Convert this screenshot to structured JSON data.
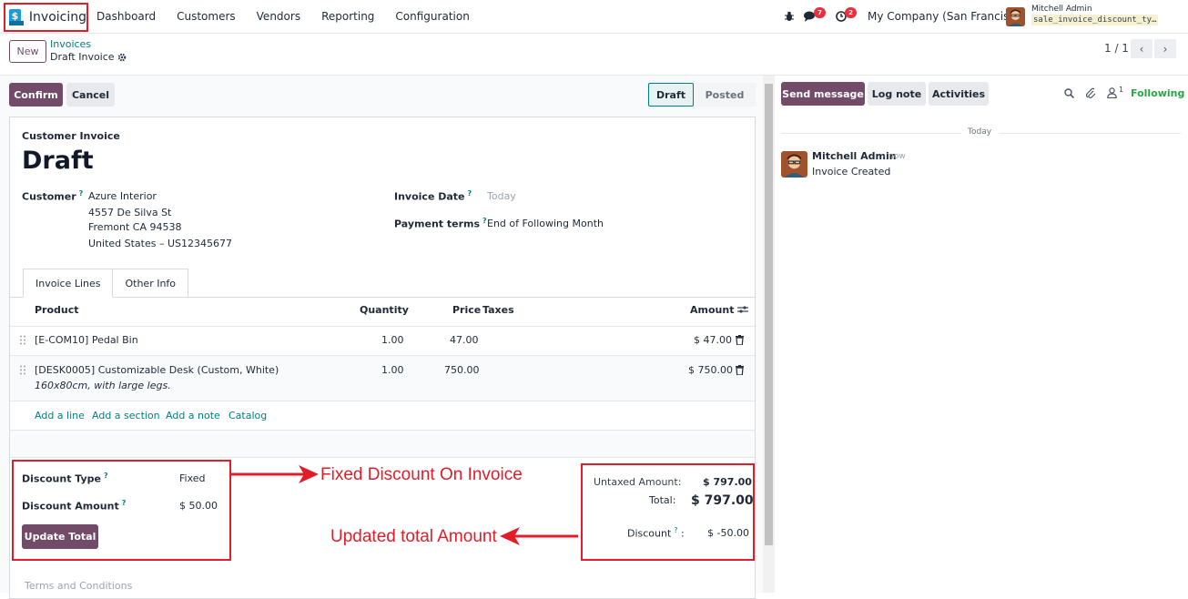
{
  "topbar": {
    "app_name": "Invoicing",
    "app_icon_glyph": "$",
    "menu": [
      "Dashboard",
      "Customers",
      "Vendors",
      "Reporting",
      "Configuration"
    ],
    "chat_count": "7",
    "activity_count": "2",
    "company": "My Company (San Francisco)",
    "user_name": "Mitchell Admin",
    "database": "sale_invoice_discount_ty…"
  },
  "control_panel": {
    "new_label": "New",
    "breadcrumb_parent": "Invoices",
    "breadcrumb_current": "Draft Invoice",
    "pager": "1 / 1"
  },
  "actions": {
    "confirm": "Confirm",
    "cancel": "Cancel",
    "status_draft": "Draft",
    "status_posted": "Posted"
  },
  "invoice": {
    "type_label": "Customer Invoice",
    "name": "Draft",
    "customer_label": "Customer",
    "customer_name": "Azure Interior",
    "address_line1": "4557 De Silva St",
    "address_line2": "Fremont CA 94538",
    "address_line3": "United States – US12345677",
    "date_label": "Invoice Date",
    "date_value": "Today",
    "terms_label": "Payment terms",
    "terms_value": "End of Following Month",
    "help_mark": "?"
  },
  "tabs": [
    "Invoice Lines",
    "Other Info"
  ],
  "lines": {
    "headers": {
      "product": "Product",
      "quantity": "Quantity",
      "price": "Price",
      "taxes": "Taxes",
      "amount": "Amount"
    },
    "rows": [
      {
        "product": "[E-COM10] Pedal Bin",
        "description": "",
        "quantity": "1.00",
        "price": "47.00",
        "amount": "$ 47.00"
      },
      {
        "product": "[DESK0005] Customizable Desk (Custom, White)",
        "description": "160x80cm, with large legs.",
        "quantity": "1.00",
        "price": "750.00",
        "amount": "$ 750.00"
      }
    ],
    "add_line": "Add a line",
    "add_section": "Add a section",
    "add_note": "Add a note",
    "catalog": "Catalog"
  },
  "discount": {
    "type_label": "Discount Type",
    "type_value": "Fixed",
    "amount_label": "Discount Amount",
    "amount_value": "$ 50.00",
    "update_button": "Update Total"
  },
  "totals": {
    "untaxed_label": "Untaxed Amount:",
    "untaxed_value": "$ 797.00",
    "total_label": "Total:",
    "total_value": "$ 797.00",
    "discount_label": "Discount",
    "discount_value": "$ -50.00"
  },
  "terms_placeholder": "Terms and Conditions",
  "annotations": {
    "fixed_discount": "Fixed Discount On Invoice",
    "updated_total": "Updated total Amount"
  },
  "chatter": {
    "send_message": "Send message",
    "log_note": "Log note",
    "activities": "Activities",
    "follower_count": "1",
    "following": "Following",
    "date_separator": "Today",
    "message_author": "Mitchell Admin",
    "message_time": "- now",
    "message_body": "Invoice Created"
  },
  "colors": {
    "brand": "#714b67",
    "teal": "#017e84",
    "annotation_red": "#e11d2a",
    "following_green": "#28a745"
  }
}
